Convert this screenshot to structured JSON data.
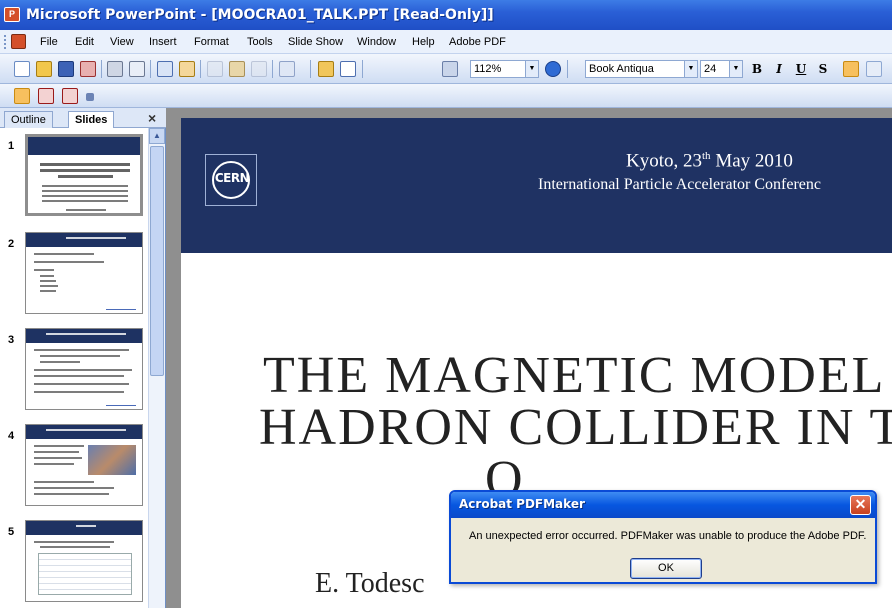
{
  "window": {
    "title": "Microsoft PowerPoint - [MOOCRA01_TALK.PPT [Read-Only]]"
  },
  "menu": [
    {
      "label": "File"
    },
    {
      "label": "Edit"
    },
    {
      "label": "View"
    },
    {
      "label": "Insert"
    },
    {
      "label": "Format"
    },
    {
      "label": "Tools"
    },
    {
      "label": "Slide Show"
    },
    {
      "label": "Window"
    },
    {
      "label": "Help"
    },
    {
      "label": "Adobe PDF"
    }
  ],
  "toolbar": {
    "zoom": "112%",
    "font": "Book Antiqua",
    "font_size": "24",
    "bold": "B",
    "italic": "I",
    "underline": "U",
    "shadow": "S",
    "dropdown_glyph": "▼",
    "icons": [
      "new-icon",
      "open-icon",
      "save-icon",
      "permission-icon",
      "print-icon",
      "print-preview-icon",
      "spelling-icon",
      "research-icon",
      "cut-icon",
      "paste-icon",
      "format-painter-icon",
      "undo-icon",
      "insert-chart-icon",
      "insert-table-icon",
      "show-grid-icon"
    ]
  },
  "pdf_toolbar": {
    "icons": [
      "convert-to-pdf-icon",
      "convert-and-email-icon",
      "convert-and-review-icon"
    ]
  },
  "left_panel": {
    "tabs": [
      {
        "label": "Outline",
        "active": false
      },
      {
        "label": "Slides",
        "active": true
      }
    ],
    "close_glyph": "×",
    "scroll_up_glyph": "▲",
    "slides": [
      {
        "number": "1"
      },
      {
        "number": "2"
      },
      {
        "number": "3"
      },
      {
        "number": "4"
      },
      {
        "number": "5"
      }
    ]
  },
  "slide": {
    "header_line1_main": "Kyoto, 23",
    "header_line1_sup": "th",
    "header_line1_end": " May 2010",
    "header_line2": "International Particle Accelerator Conferenc",
    "logo_text": "CERN",
    "title_line1": "THE MAGNETIC MODEL OF",
    "title_line2": "HADRON COLLIDER IN THE",
    "title_line3": "O",
    "author": "E. Todesc"
  },
  "dialog": {
    "title": "Acrobat PDFMaker",
    "close_glyph": "✕",
    "message": "An unexpected error occurred. PDFMaker was unable to produce the Adobe PDF.",
    "ok_label": "OK"
  }
}
